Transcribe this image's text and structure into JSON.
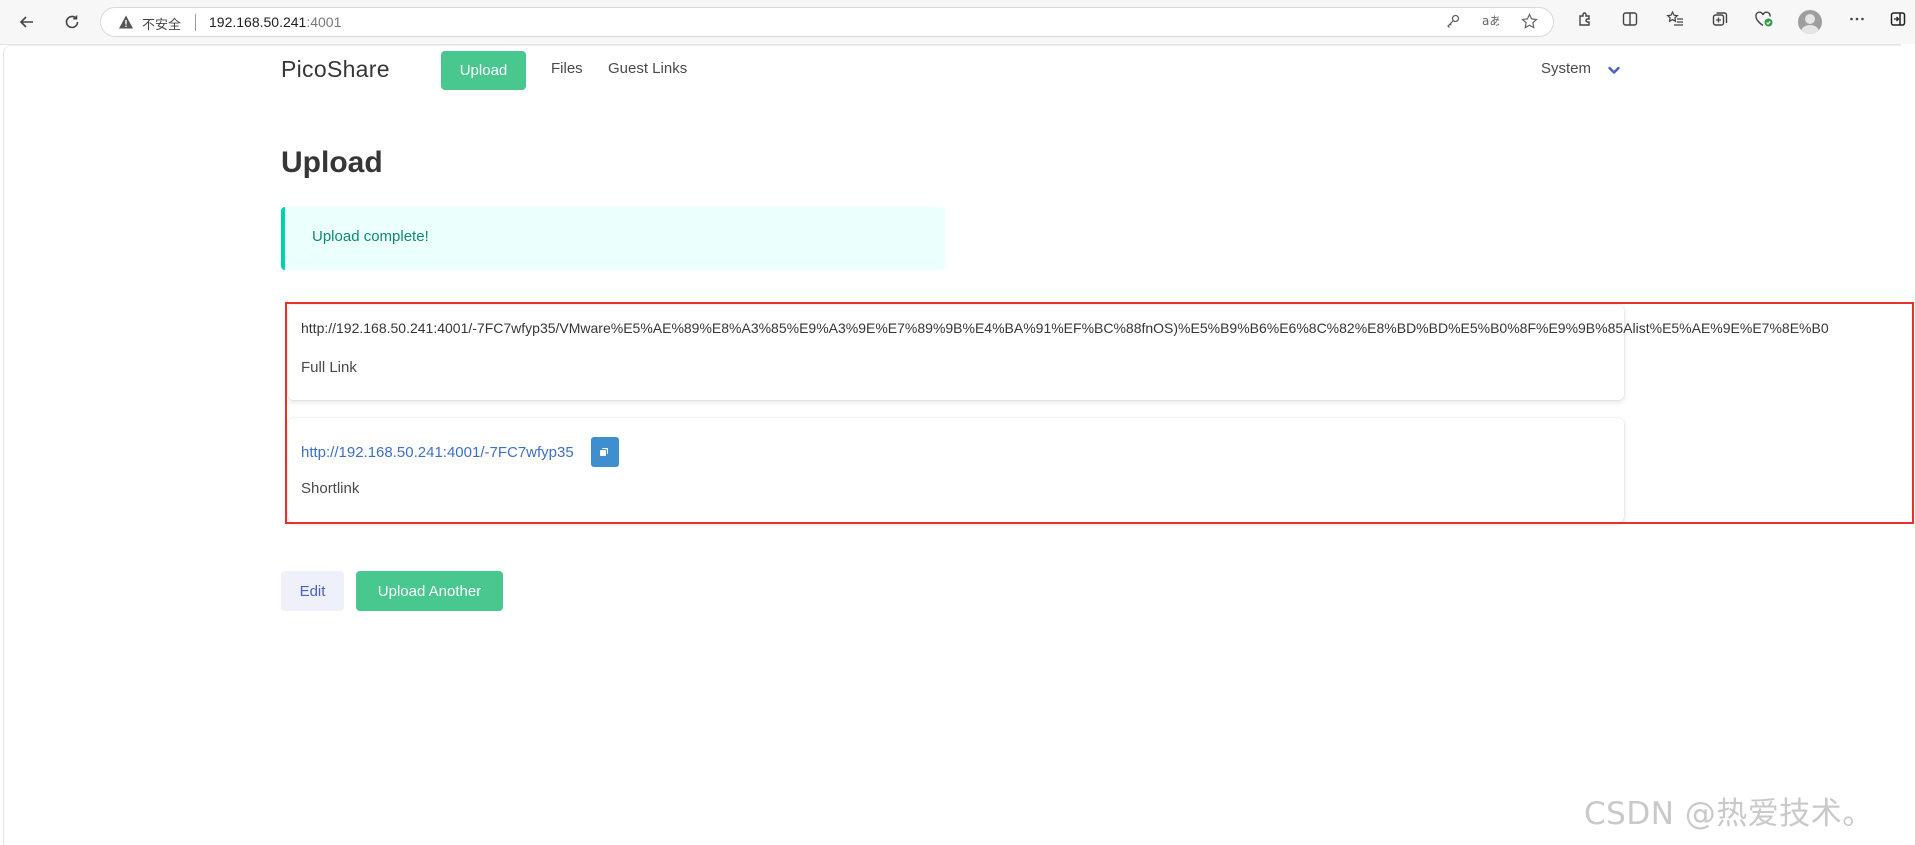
{
  "browser": {
    "security_label": "不安全",
    "address_host": "192.168.50.241",
    "address_port": ":4001"
  },
  "app": {
    "brand": "PicoShare",
    "nav": {
      "upload": "Upload",
      "files": "Files",
      "guest_links": "Guest Links"
    },
    "system_menu": "System",
    "accent_color": "#48c78e"
  },
  "page": {
    "title": "Upload",
    "notice": "Upload complete!",
    "full_link": {
      "url": "http://192.168.50.241:4001/-7FC7wfyp35/VMware%E5%AE%89%E8%A3%85%E9%A3%9E%E7%89%9B%E4%BA%91%EF%BC%88fnOS)%E5%B9%B6%E6%8C%82%E8%BD%BD%E5%B0%8F%E9%9B%85Alist%E5%AE%9E%E7%8E%B0",
      "label": "Full Link"
    },
    "short_link": {
      "url": "http://192.168.50.241:4001/-7FC7wfyp35",
      "label": "Shortlink"
    },
    "buttons": {
      "edit": "Edit",
      "upload_another": "Upload Another"
    }
  },
  "watermark": "CSDN @热爱技术。"
}
